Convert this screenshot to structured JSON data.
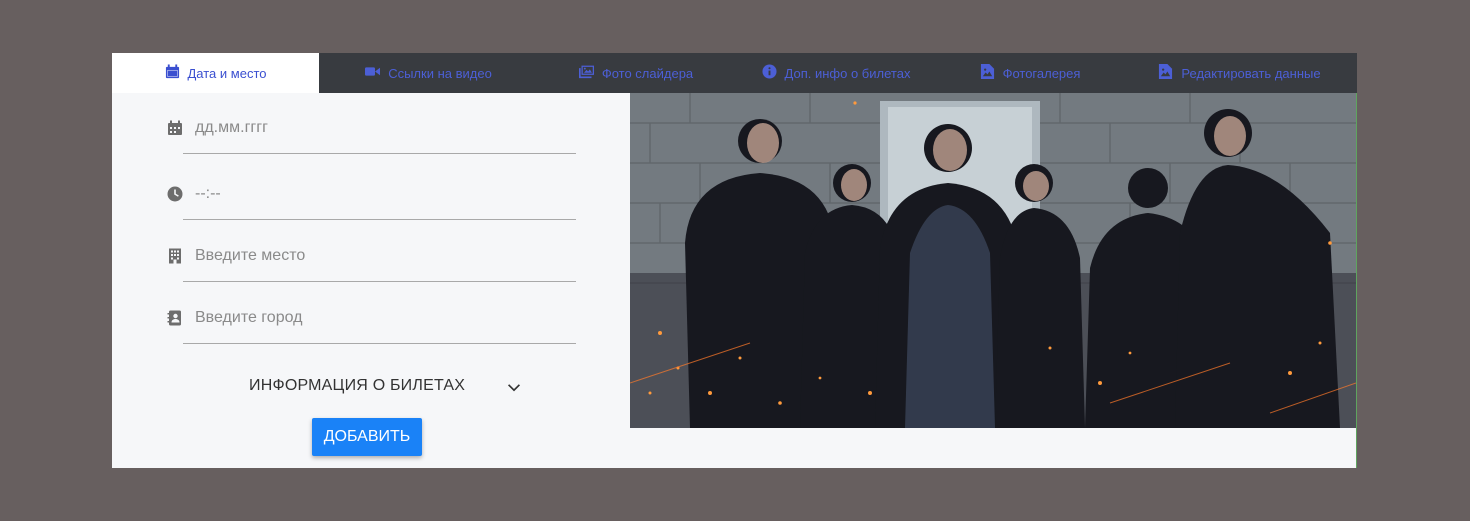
{
  "tabs": [
    {
      "label": "Дата и место",
      "icon": "calendar-icon",
      "active": true
    },
    {
      "label": "Ссылки на видео",
      "icon": "video-camera-icon",
      "active": false
    },
    {
      "label": "Фото слайдера",
      "icon": "images-icon",
      "active": false
    },
    {
      "label": "Доп. инфо о билетах",
      "icon": "info-circle-icon",
      "active": false
    },
    {
      "label": "Фотогалерея",
      "icon": "image-file-icon",
      "active": false
    },
    {
      "label": "Редактировать данные",
      "icon": "image-file-icon",
      "active": false
    }
  ],
  "form": {
    "date": {
      "placeholder": "дд.мм.гггг",
      "value": "",
      "icon": "calendar-icon"
    },
    "time": {
      "placeholder": "--:--",
      "value": "",
      "icon": "clock-icon"
    },
    "place": {
      "placeholder": "Введите место",
      "value": "",
      "icon": "building-icon"
    },
    "city": {
      "placeholder": "Введите город",
      "value": "",
      "icon": "address-book-icon"
    },
    "ticket_info_label": "ИНФОРМАЦИЯ О БИЛЕТАХ",
    "add_button_label": "ДОБАВИТЬ"
  },
  "colors": {
    "page_background": "#675f5f",
    "tab_bar": "#383b40",
    "tab_text": "#4c5fd6",
    "primary_button": "#1a82f7",
    "panel_background": "#f6f7f9"
  }
}
